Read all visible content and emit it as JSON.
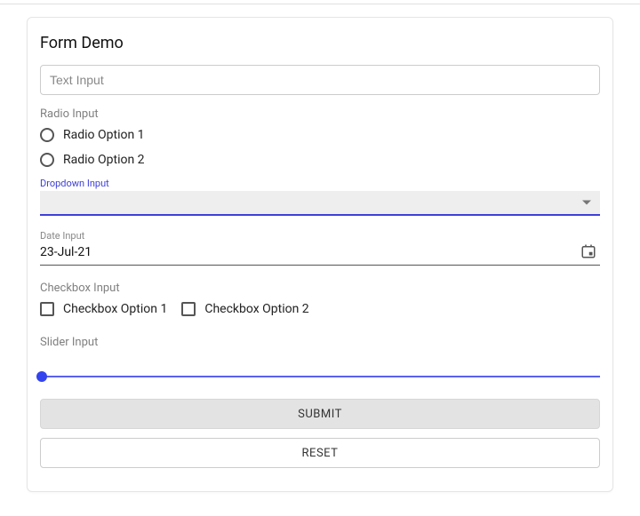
{
  "title": "Form Demo",
  "textInput": {
    "placeholder": "Text Input"
  },
  "radio": {
    "label": "Radio Input",
    "options": [
      "Radio Option 1",
      "Radio Option 2"
    ]
  },
  "dropdown": {
    "label": "Dropdown Input"
  },
  "date": {
    "label": "Date Input",
    "value": "23-Jul-21"
  },
  "checkbox": {
    "label": "Checkbox Input",
    "options": [
      "Checkbox Option 1",
      "Checkbox Option 2"
    ]
  },
  "slider": {
    "label": "Slider Input"
  },
  "buttons": {
    "submit": "SUBMIT",
    "reset": "RESET"
  }
}
